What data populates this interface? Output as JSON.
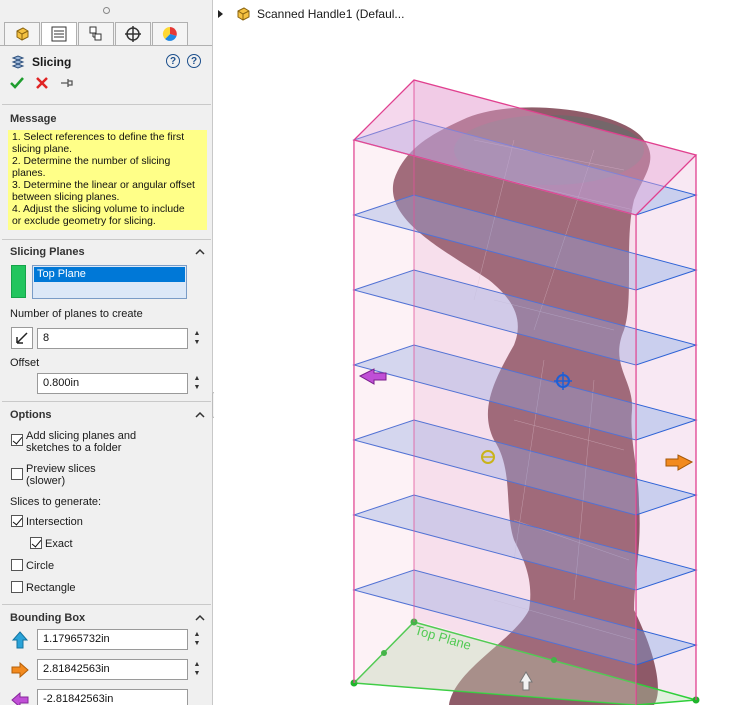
{
  "tabs": [
    "feature-manager-icon",
    "property-manager-icon",
    "configuration-manager-icon",
    "dimxpert-icon",
    "display-manager-icon"
  ],
  "pm": {
    "title": "Slicing",
    "help_label": "?",
    "help_label2": "?"
  },
  "message": {
    "heading": "Message",
    "lines": [
      "1. Select references to define the first",
      "slicing plane.",
      "2. Determine the number of slicing",
      "planes.",
      "3. Determine the linear or angular offset",
      "between slicing planes.",
      "4. Adjust the slicing volume to include",
      "or exclude geometry for slicing."
    ]
  },
  "slicing_planes": {
    "heading": "Slicing Planes",
    "selected": "Top Plane",
    "count_label": "Number of planes to create",
    "count_value": "8",
    "offset_label": "Offset",
    "offset_value": "0.800in"
  },
  "options": {
    "heading": "Options",
    "add_folder": "Add slicing planes and sketches to a folder",
    "add_folder_l1": "Add slicing planes and",
    "add_folder_l2": "sketches to a folder",
    "preview_l1": "Preview slices",
    "preview_l2": "(slower)",
    "slices_label": "Slices to generate:",
    "intersection": "Intersection",
    "exact": "Exact",
    "circle": "Circle",
    "rectangle": "Rectangle",
    "checked": {
      "add_folder": true,
      "preview": false,
      "intersection": true,
      "exact": true,
      "circle": false,
      "rectangle": false
    }
  },
  "bounding_box": {
    "heading": "Bounding Box",
    "values": [
      "1.17965732in",
      "2.81842563in",
      "-2.81842563in"
    ]
  },
  "viewport": {
    "tree_label": "Scanned Handle1  (Defaul...",
    "plane_label": "Top Plane"
  },
  "colors": {
    "box_edge": "#e0408f",
    "plane_fill": "#7ea6e8",
    "plane_edge": "#2f63d6",
    "body": "#7a3a4a",
    "selected_plane_edge": "#2fcf3a"
  }
}
